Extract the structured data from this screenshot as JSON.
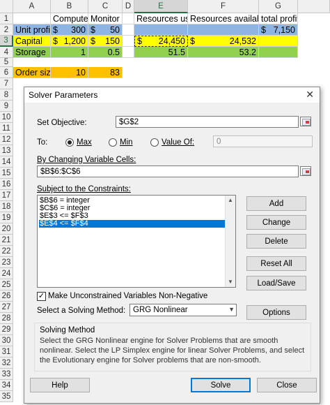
{
  "sheet": {
    "columns": [
      "A",
      "B",
      "C",
      "D",
      "E",
      "F",
      "G"
    ],
    "rows": [
      "1",
      "2",
      "3",
      "4",
      "5",
      "6",
      "7",
      "8",
      "9",
      "10",
      "11",
      "12",
      "13",
      "14",
      "15",
      "16",
      "17",
      "18",
      "19",
      "20",
      "21",
      "22",
      "23",
      "24",
      "25",
      "26",
      "27",
      "28",
      "29",
      "30",
      "31",
      "32",
      "33",
      "34",
      "35"
    ],
    "cells": {
      "b1": "Computer",
      "c1": "Monitor",
      "e1": "Resources used",
      "f1": "Resources available",
      "g1": "total profit",
      "a2": "Unit profit",
      "b2_cur": "$",
      "b2": "300",
      "c2_cur": "$",
      "c2": "50",
      "g2_cur": "$",
      "g2": "7,150",
      "a3": "Capital",
      "b3_cur": "$",
      "b3": "1,200",
      "c3_cur": "$",
      "c3": "150",
      "e3_cur": "$",
      "e3": "24,450",
      "f3_cur": "$",
      "f3": "24,532",
      "a4": "Storage",
      "b4": "1",
      "c4": "0.5",
      "e4": "51.5",
      "f4": "53.2",
      "a6": "Order size",
      "b6": "10",
      "c6": "83"
    },
    "colors": {
      "blue": "#8db4e2",
      "yellow": "#ffff00",
      "green": "#92d050",
      "orange": "#ffc000"
    }
  },
  "dialog": {
    "title": "Solver Parameters",
    "close_icon": "close-icon",
    "set_objective_label": "Set Objective:",
    "objective_value": "$G$2",
    "to_label": "To:",
    "max_label": "Max",
    "min_label": "Min",
    "value_of_label": "Value Of:",
    "value_of_value": "0",
    "selected_goal": "Max",
    "changing_cells_label": "By Changing Variable Cells:",
    "changing_cells_value": "$B$6:$C$6",
    "constraints_label": "Subject to the Constraints:",
    "constraints": [
      "$B$6 = integer",
      "$C$6 = integer",
      "$E$3 <= $F$3",
      "$E$4 <= $F$4"
    ],
    "selected_constraint": "$E$4 <= $F$4",
    "buttons": {
      "add": "Add",
      "change": "Change",
      "delete": "Delete",
      "reset_all": "Reset All",
      "load_save": "Load/Save",
      "options": "Options",
      "help": "Help",
      "solve": "Solve",
      "close": "Close"
    },
    "nonneg_label": "Make Unconstrained Variables Non-Negative",
    "nonneg_checked": true,
    "method_label": "Select a Solving Method:",
    "method_value": "GRG Nonlinear",
    "solving_method_title": "Solving Method",
    "solving_method_text": "Select the GRG Nonlinear engine for Solver Problems that are smooth nonlinear. Select the LP Simplex engine for linear Solver Problems, and select the Evolutionary engine for Solver problems that are non-smooth."
  }
}
